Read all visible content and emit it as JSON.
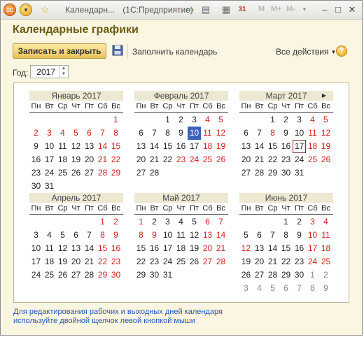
{
  "window": {
    "title": "Календарн...",
    "app": "(1С:Предприятие)",
    "mem_labels": [
      "M",
      "M+",
      "M-"
    ]
  },
  "form": {
    "title": "Календарные графики",
    "save_close": "Записать и закрыть",
    "fill_calendar": "Заполнить календарь",
    "all_actions": "Все действия",
    "help": "?",
    "year_label": "Год:",
    "year_value": "2017"
  },
  "calendar": {
    "weekdays": [
      "Пн",
      "Вт",
      "Ср",
      "Чт",
      "Пт",
      "Сб",
      "Вс"
    ],
    "months": [
      {
        "name": "Январь 2017",
        "offset": 6,
        "days": 31,
        "holidays": [
          1,
          2,
          3,
          4,
          5,
          6,
          7,
          8,
          14,
          15,
          21,
          22,
          28,
          29
        ],
        "trailing": []
      },
      {
        "name": "Февраль 2017",
        "offset": 2,
        "days": 28,
        "holidays": [
          4,
          5,
          11,
          12,
          18,
          19,
          23,
          24,
          25,
          26
        ],
        "selected": 10,
        "trailing": []
      },
      {
        "name": "Март 2017",
        "offset": 2,
        "days": 31,
        "holidays": [
          4,
          5,
          8,
          11,
          12,
          18,
          19,
          25,
          26
        ],
        "today": 17,
        "trailing": []
      },
      {
        "name": "Апрель 2017",
        "offset": 5,
        "days": 30,
        "holidays": [
          1,
          2,
          8,
          9,
          15,
          16,
          22,
          23,
          29,
          30
        ],
        "trailing": []
      },
      {
        "name": "Май 2017",
        "offset": 0,
        "days": 31,
        "holidays": [
          1,
          6,
          7,
          8,
          9,
          13,
          14,
          20,
          21,
          27,
          28
        ],
        "trailing": []
      },
      {
        "name": "Июнь 2017",
        "offset": 3,
        "days": 30,
        "holidays": [
          3,
          4,
          10,
          11,
          12,
          17,
          18,
          24,
          25
        ],
        "trailing": [
          1,
          2,
          3,
          4,
          5,
          6,
          7,
          8,
          9
        ]
      }
    ]
  },
  "hint": {
    "line1": "Для редактирования рабочих и выходных дней календаря",
    "line2": "используйте двойной щелчок левой кнопкой мыши"
  },
  "colors": {
    "holiday": "#d21f1f",
    "selected": "#3d63b9",
    "accent": "#e8c25a"
  }
}
